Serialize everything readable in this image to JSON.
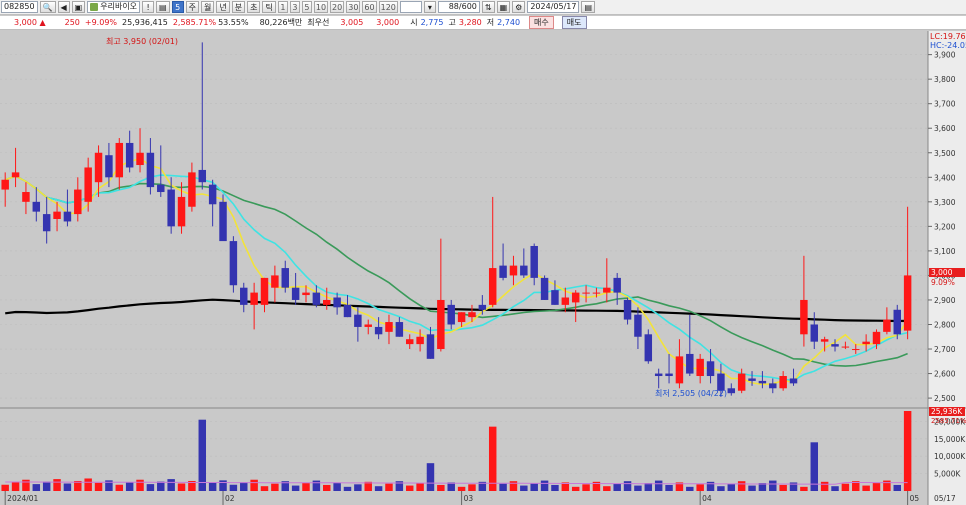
{
  "toolbar": {
    "code": "082850",
    "stock_name": "우리바이오",
    "fav_label": "5",
    "period_tabs": [
      "주",
      "월",
      "년",
      "분",
      "초",
      "틱"
    ],
    "minute_options": [
      "1",
      "3",
      "5",
      "10",
      "20",
      "30",
      "60",
      "120"
    ],
    "count_value": "88",
    "count_total": "600",
    "date": "2024/05/17"
  },
  "quote": {
    "price": "3,000 ▲",
    "change": "250",
    "change_pct": "+9.09%",
    "volume": "25,936,415",
    "volume_ratio": "2,585.71%",
    "turnover": "53.55%",
    "amount": "80,226백만",
    "best_ask_label": "최우선",
    "best_ask": "3,005",
    "best_bid": "3,000",
    "open_label": "시",
    "open": "2,775",
    "high_label": "고",
    "high": "3,280",
    "low_label": "저",
    "low": "2,740",
    "buy_label": "매수",
    "sell_label": "매도"
  },
  "chart_data": {
    "type": "candlestick",
    "price_axis_ticks": [
      "3,900",
      "3,800",
      "3,700",
      "3,600",
      "3,500",
      "3,400",
      "3,300",
      "3,200",
      "3,100",
      "3,000",
      "2,900",
      "2,800",
      "2,700",
      "2,600",
      "2,500"
    ],
    "volume_axis_ticks": [
      "20,000K",
      "15,000K",
      "10,000K",
      "5,000K"
    ],
    "date_labels": [
      "2024/01",
      "02",
      "03",
      "04",
      "05",
      "05/17"
    ],
    "lc_label": "LC:19.76",
    "hc_label": "HC:-24.05",
    "current_price_tag": "3,000",
    "current_change_tag": "9.09%",
    "volume_tag": "25,936K",
    "volume_pct_tag": "2585.71%",
    "high_annotation": "최고 3,950 (02/01)",
    "low_annotation": "최저 2,505 (04/22)",
    "y_range": [
      2480,
      3980
    ],
    "candles": [
      {
        "o": 3350,
        "h": 3420,
        "l": 3280,
        "c": 3390
      },
      {
        "o": 3400,
        "h": 3520,
        "l": 3360,
        "c": 3420
      },
      {
        "o": 3300,
        "h": 3380,
        "l": 3250,
        "c": 3340
      },
      {
        "o": 3300,
        "h": 3360,
        "l": 3220,
        "c": 3260
      },
      {
        "o": 3250,
        "h": 3320,
        "l": 3130,
        "c": 3180
      },
      {
        "o": 3230,
        "h": 3300,
        "l": 3180,
        "c": 3260
      },
      {
        "o": 3260,
        "h": 3350,
        "l": 3200,
        "c": 3220
      },
      {
        "o": 3250,
        "h": 3400,
        "l": 3220,
        "c": 3350
      },
      {
        "o": 3300,
        "h": 3480,
        "l": 3260,
        "c": 3440
      },
      {
        "o": 3380,
        "h": 3530,
        "l": 3320,
        "c": 3500
      },
      {
        "o": 3490,
        "h": 3540,
        "l": 3360,
        "c": 3400
      },
      {
        "o": 3400,
        "h": 3560,
        "l": 3350,
        "c": 3540
      },
      {
        "o": 3540,
        "h": 3590,
        "l": 3420,
        "c": 3440
      },
      {
        "o": 3450,
        "h": 3600,
        "l": 3420,
        "c": 3500
      },
      {
        "o": 3500,
        "h": 3560,
        "l": 3330,
        "c": 3360
      },
      {
        "o": 3370,
        "h": 3530,
        "l": 3320,
        "c": 3340
      },
      {
        "o": 3350,
        "h": 3400,
        "l": 3170,
        "c": 3200
      },
      {
        "o": 3200,
        "h": 3380,
        "l": 3170,
        "c": 3320
      },
      {
        "o": 3280,
        "h": 3460,
        "l": 3260,
        "c": 3420
      },
      {
        "o": 3430,
        "h": 3950,
        "l": 3350,
        "c": 3380
      },
      {
        "o": 3370,
        "h": 3390,
        "l": 3200,
        "c": 3290
      },
      {
        "o": 3300,
        "h": 3330,
        "l": 3150,
        "c": 3140
      },
      {
        "o": 3140,
        "h": 3160,
        "l": 2930,
        "c": 2960
      },
      {
        "o": 2950,
        "h": 2970,
        "l": 2850,
        "c": 2880
      },
      {
        "o": 2880,
        "h": 2970,
        "l": 2780,
        "c": 2930
      },
      {
        "o": 2880,
        "h": 2990,
        "l": 2850,
        "c": 2990
      },
      {
        "o": 2950,
        "h": 3040,
        "l": 2890,
        "c": 3000
      },
      {
        "o": 3030,
        "h": 3060,
        "l": 2930,
        "c": 2950
      },
      {
        "o": 2950,
        "h": 3010,
        "l": 2880,
        "c": 2900
      },
      {
        "o": 2920,
        "h": 2960,
        "l": 2890,
        "c": 2930
      },
      {
        "o": 2930,
        "h": 2960,
        "l": 2870,
        "c": 2880
      },
      {
        "o": 2880,
        "h": 2950,
        "l": 2860,
        "c": 2900
      },
      {
        "o": 2910,
        "h": 2930,
        "l": 2840,
        "c": 2870
      },
      {
        "o": 2880,
        "h": 2920,
        "l": 2830,
        "c": 2830
      },
      {
        "o": 2840,
        "h": 2870,
        "l": 2730,
        "c": 2790
      },
      {
        "o": 2790,
        "h": 2820,
        "l": 2760,
        "c": 2800
      },
      {
        "o": 2790,
        "h": 2830,
        "l": 2740,
        "c": 2760
      },
      {
        "o": 2770,
        "h": 2840,
        "l": 2720,
        "c": 2810
      },
      {
        "o": 2810,
        "h": 2830,
        "l": 2750,
        "c": 2750
      },
      {
        "o": 2720,
        "h": 2760,
        "l": 2700,
        "c": 2740
      },
      {
        "o": 2720,
        "h": 2780,
        "l": 2690,
        "c": 2750
      },
      {
        "o": 2760,
        "h": 2790,
        "l": 2660,
        "c": 2660
      },
      {
        "o": 2700,
        "h": 3150,
        "l": 2690,
        "c": 2900
      },
      {
        "o": 2880,
        "h": 2900,
        "l": 2780,
        "c": 2800
      },
      {
        "o": 2810,
        "h": 2850,
        "l": 2790,
        "c": 2850
      },
      {
        "o": 2830,
        "h": 2880,
        "l": 2810,
        "c": 2850
      },
      {
        "o": 2880,
        "h": 2920,
        "l": 2840,
        "c": 2860
      },
      {
        "o": 2880,
        "h": 3320,
        "l": 2870,
        "c": 3030
      },
      {
        "o": 3040,
        "h": 3130,
        "l": 2980,
        "c": 2990
      },
      {
        "o": 3000,
        "h": 3080,
        "l": 2960,
        "c": 3040
      },
      {
        "o": 3040,
        "h": 3110,
        "l": 2990,
        "c": 3000
      },
      {
        "o": 3120,
        "h": 3130,
        "l": 2960,
        "c": 2990
      },
      {
        "o": 2990,
        "h": 3000,
        "l": 2900,
        "c": 2900
      },
      {
        "o": 2940,
        "h": 2980,
        "l": 2880,
        "c": 2880
      },
      {
        "o": 2880,
        "h": 2950,
        "l": 2850,
        "c": 2910
      },
      {
        "o": 2890,
        "h": 2940,
        "l": 2810,
        "c": 2930
      },
      {
        "o": 2930,
        "h": 2960,
        "l": 2890,
        "c": 2930
      },
      {
        "o": 2930,
        "h": 2950,
        "l": 2910,
        "c": 2930
      },
      {
        "o": 2930,
        "h": 3070,
        "l": 2890,
        "c": 2950
      },
      {
        "o": 2990,
        "h": 3010,
        "l": 2880,
        "c": 2930
      },
      {
        "o": 2900,
        "h": 2910,
        "l": 2800,
        "c": 2820
      },
      {
        "o": 2840,
        "h": 2870,
        "l": 2700,
        "c": 2750
      },
      {
        "o": 2760,
        "h": 2780,
        "l": 2640,
        "c": 2650
      },
      {
        "o": 2600,
        "h": 2620,
        "l": 2540,
        "c": 2590
      },
      {
        "o": 2600,
        "h": 2680,
        "l": 2560,
        "c": 2590
      },
      {
        "o": 2560,
        "h": 2740,
        "l": 2540,
        "c": 2670
      },
      {
        "o": 2680,
        "h": 2840,
        "l": 2590,
        "c": 2600
      },
      {
        "o": 2590,
        "h": 2680,
        "l": 2560,
        "c": 2660
      },
      {
        "o": 2650,
        "h": 2700,
        "l": 2560,
        "c": 2590
      },
      {
        "o": 2600,
        "h": 2640,
        "l": 2505,
        "c": 2530
      },
      {
        "o": 2540,
        "h": 2560,
        "l": 2510,
        "c": 2520
      },
      {
        "o": 2530,
        "h": 2620,
        "l": 2520,
        "c": 2600
      },
      {
        "o": 2580,
        "h": 2610,
        "l": 2550,
        "c": 2570
      },
      {
        "o": 2570,
        "h": 2610,
        "l": 2540,
        "c": 2560
      },
      {
        "o": 2560,
        "h": 2580,
        "l": 2520,
        "c": 2540
      },
      {
        "o": 2540,
        "h": 2610,
        "l": 2530,
        "c": 2590
      },
      {
        "o": 2580,
        "h": 2620,
        "l": 2550,
        "c": 2560
      },
      {
        "o": 2760,
        "h": 3080,
        "l": 2710,
        "c": 2900
      },
      {
        "o": 2800,
        "h": 2850,
        "l": 2700,
        "c": 2730
      },
      {
        "o": 2730,
        "h": 2750,
        "l": 2690,
        "c": 2740
      },
      {
        "o": 2720,
        "h": 2740,
        "l": 2690,
        "c": 2710
      },
      {
        "o": 2710,
        "h": 2730,
        "l": 2700,
        "c": 2710
      },
      {
        "o": 2700,
        "h": 2720,
        "l": 2680,
        "c": 2700
      },
      {
        "o": 2720,
        "h": 2760,
        "l": 2690,
        "c": 2730
      },
      {
        "o": 2720,
        "h": 2780,
        "l": 2700,
        "c": 2770
      },
      {
        "o": 2770,
        "h": 2870,
        "l": 2760,
        "c": 2820
      },
      {
        "o": 2860,
        "h": 2880,
        "l": 2740,
        "c": 2760
      },
      {
        "o": 2775,
        "h": 3280,
        "l": 2740,
        "c": 3000
      }
    ],
    "volume_max": 23000,
    "colors": {
      "up": "#ff1717",
      "down": "#3434b0",
      "ma5": "#f2e33a",
      "ma10": "#3fe3e3",
      "ma20": "#3a9a5a",
      "ma60": "#000000",
      "background": "#c9c9c9"
    }
  }
}
